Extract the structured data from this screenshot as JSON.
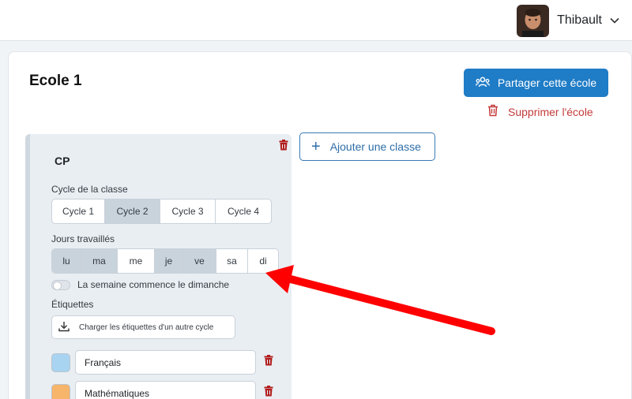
{
  "header": {
    "username": "Thibault",
    "avatar_icon": "user-avatar",
    "menu_icon": "chevron-down-icon"
  },
  "school": {
    "title": "Ecole 1",
    "share_label": "Partager cette école",
    "delete_label": "Supprimer l'école",
    "add_class_label": "Ajouter une classe"
  },
  "class_card": {
    "name": "CP",
    "cycle_label": "Cycle de la classe",
    "cycles": [
      {
        "label": "Cycle 1",
        "selected": false
      },
      {
        "label": "Cycle 2",
        "selected": true
      },
      {
        "label": "Cycle 3",
        "selected": false
      },
      {
        "label": "Cycle 4",
        "selected": false
      }
    ],
    "days_label": "Jours travaillés",
    "days": [
      {
        "label": "lu",
        "selected": true
      },
      {
        "label": "ma",
        "selected": true
      },
      {
        "label": "me",
        "selected": false
      },
      {
        "label": "je",
        "selected": true
      },
      {
        "label": "ve",
        "selected": true
      },
      {
        "label": "sa",
        "selected": false
      },
      {
        "label": "di",
        "selected": false
      }
    ],
    "sunday_toggle_label": "La semaine commence le dimanche",
    "sunday_toggle_on": false,
    "tags_label": "Étiquettes",
    "load_tags_label": "Charger les étiquettes d'un autre cycle",
    "tags": [
      {
        "name": "Français",
        "color": "#a8d4f2"
      },
      {
        "name": "Mathématiques",
        "color": "#f7b46b"
      }
    ]
  },
  "colors": {
    "primary": "#1f7cc6",
    "danger": "#c33a3a",
    "annotation_arrow": "#ff0000"
  }
}
